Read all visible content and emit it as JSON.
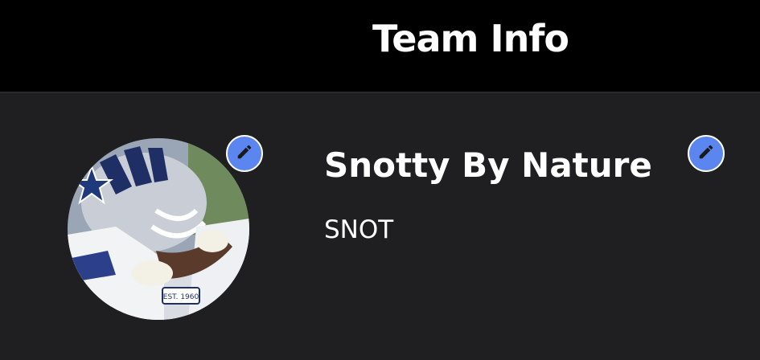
{
  "header": {
    "title": "Team Info"
  },
  "team": {
    "name": "Snotty By Nature",
    "abbreviation": "SNOT",
    "avatar_icon": "football-player-photo",
    "avatar_badge_text": "EST. 1960"
  },
  "icons": {
    "edit_avatar": "pencil-icon",
    "edit_name": "pencil-icon"
  },
  "colors": {
    "background": "#000000",
    "card": "#1f1f21",
    "accent": "#5b86f0",
    "text": "#ffffff"
  }
}
